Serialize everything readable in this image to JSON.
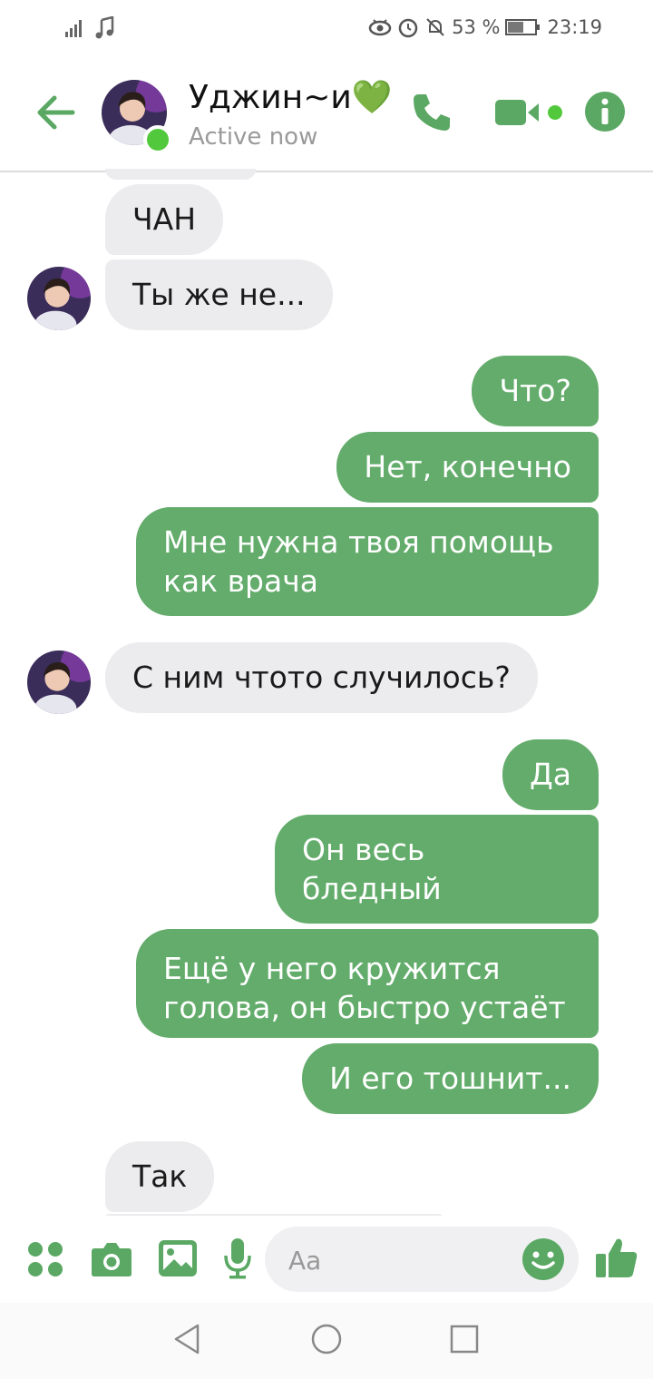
{
  "status_bar": {
    "battery": "53 %",
    "time": "23:19"
  },
  "header": {
    "contact_name": "Уджин~и💚",
    "status": "Active now"
  },
  "messages": [
    {
      "text": "ЧАН"
    },
    {
      "text": "Ты же не..."
    },
    {
      "text": "Что?"
    },
    {
      "text": "Нет, конечно"
    },
    {
      "text": "Мне нужна твоя помощь как врача"
    },
    {
      "text": "С ним чтото случилось?"
    },
    {
      "text": "Да"
    },
    {
      "text": "Он весь бледный"
    },
    {
      "text": "Ещё у него кружится голова, он быстро устаёт"
    },
    {
      "text": "И его тошнит..."
    },
    {
      "text": "Так"
    }
  ],
  "composer": {
    "placeholder": "Aa"
  },
  "colors": {
    "accent": "#5aa863",
    "outgoing_bubble": "#63ac6b",
    "incoming_bubble": "#ececee",
    "online": "#52c93d"
  },
  "icons": [
    "back-arrow-icon",
    "phone-icon",
    "video-camera-icon",
    "info-icon",
    "apps-icon",
    "camera-icon",
    "gallery-icon",
    "microphone-icon",
    "emoji-icon",
    "thumbs-up-icon",
    "nav-back-icon",
    "nav-home-icon",
    "nav-recents-icon"
  ]
}
